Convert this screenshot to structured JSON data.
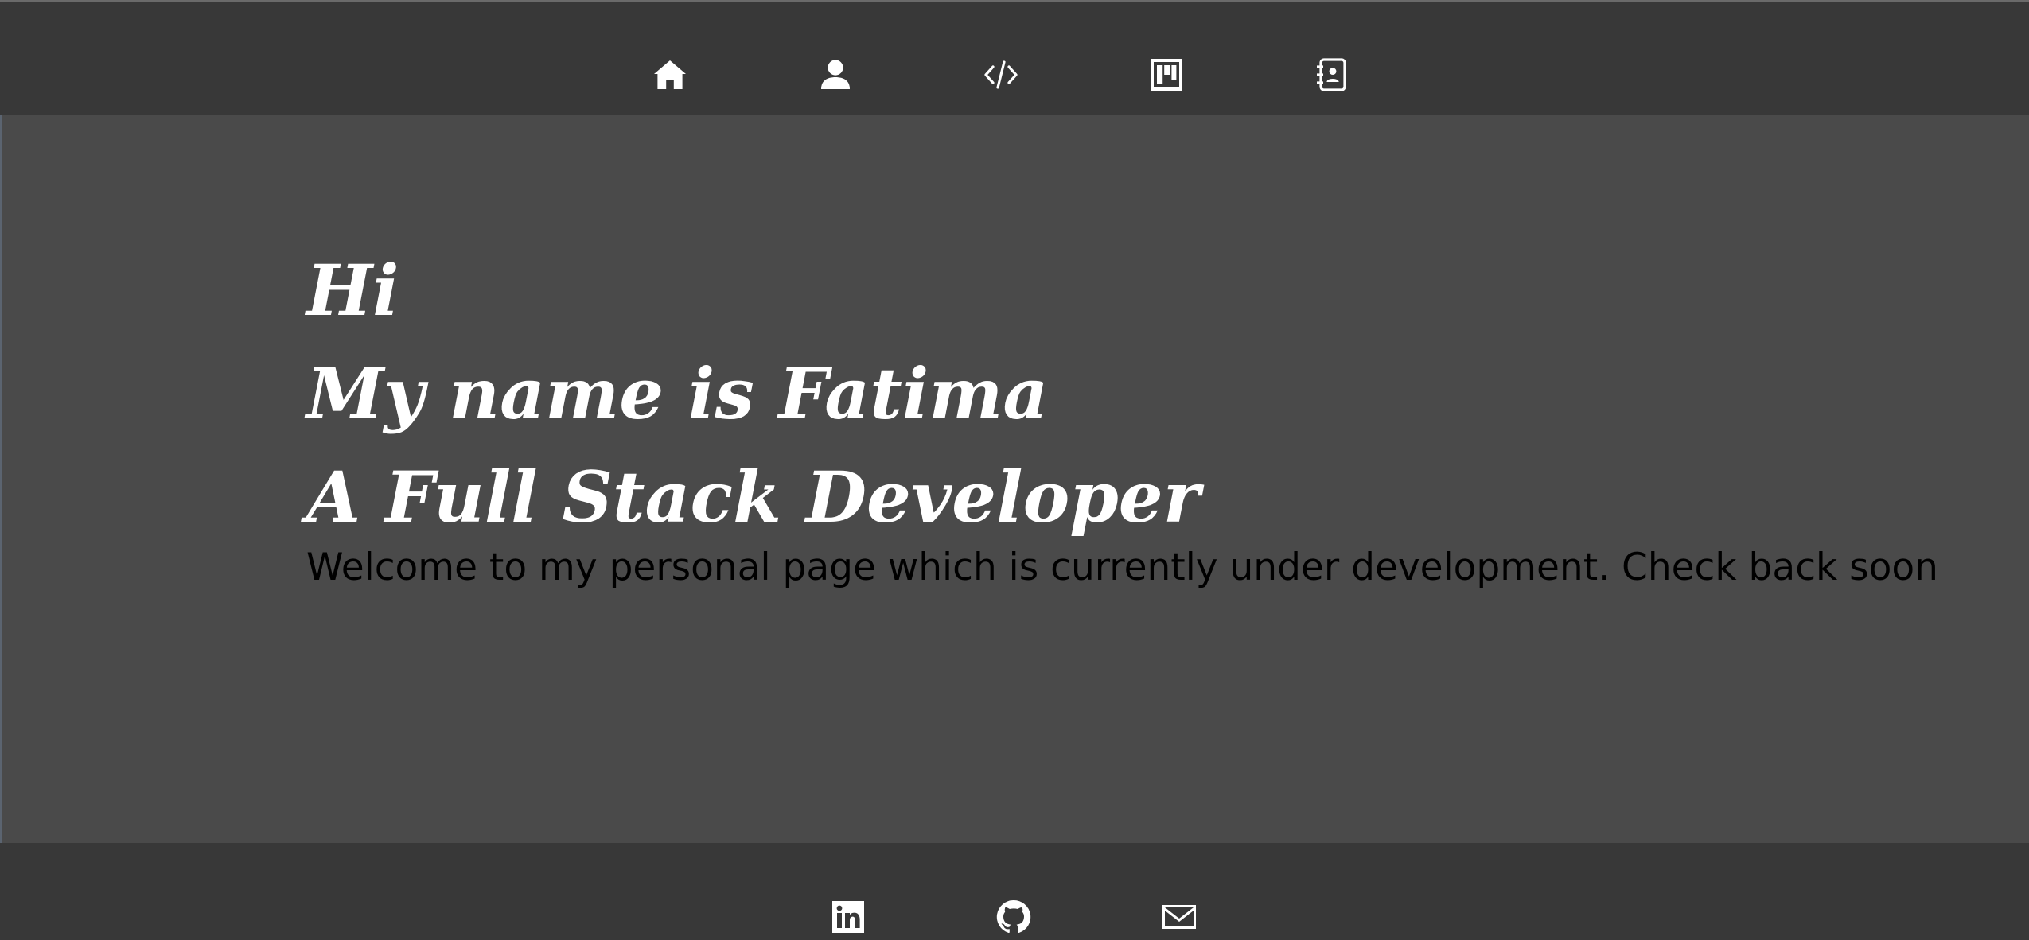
{
  "nav": {
    "items": [
      {
        "icon": "home-icon",
        "label": "Home"
      },
      {
        "icon": "user-icon",
        "label": "About"
      },
      {
        "icon": "code-icon",
        "label": "Projects"
      },
      {
        "icon": "kanban-icon",
        "label": "Board"
      },
      {
        "icon": "contact-book-icon",
        "label": "Contact"
      }
    ]
  },
  "hero": {
    "line1": "Hi",
    "line2": "My name is Fatima",
    "line3": "A Full Stack Developer",
    "welcome": "Welcome to my personal page which is currently under development. Check back soon"
  },
  "footer": {
    "items": [
      {
        "icon": "linkedin-icon"
      },
      {
        "icon": "github-icon"
      },
      {
        "icon": "mail-icon"
      }
    ]
  },
  "colors": {
    "page_bg": "#4a4a4a",
    "bar_bg": "#383838",
    "hero_text": "#ffffff",
    "welcome_text": "#000000"
  }
}
